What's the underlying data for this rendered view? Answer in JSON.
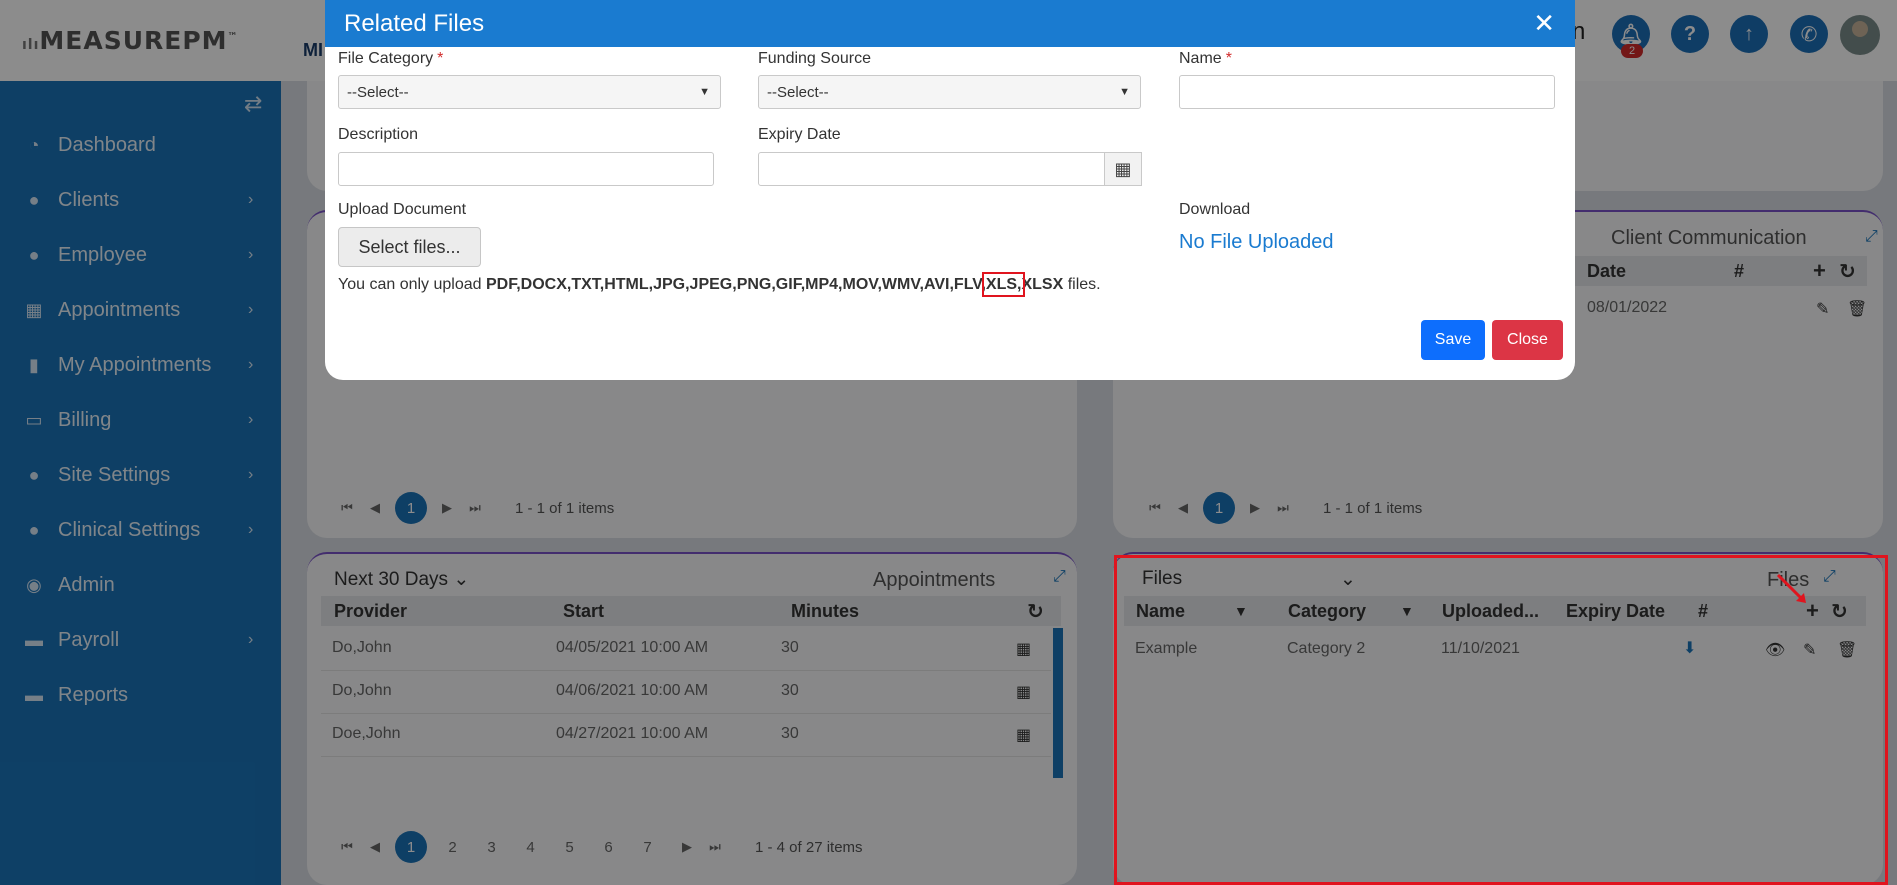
{
  "header": {
    "logo": "MEASUREPM",
    "logo_tm": "™",
    "logo2": "MI",
    "partial_title": "n",
    "notification_count": "2"
  },
  "sidebar": {
    "items": [
      {
        "label": "Dashboard",
        "icon": "dashboard-icon",
        "glyph": "◔",
        "chevron": false
      },
      {
        "label": "Clients",
        "icon": "user-icon",
        "glyph": "●",
        "chevron": true
      },
      {
        "label": "Employee",
        "icon": "users-icon",
        "glyph": "●",
        "chevron": true
      },
      {
        "label": "Appointments",
        "icon": "calendar-icon",
        "glyph": "▦",
        "chevron": true
      },
      {
        "label": "My Appointments",
        "icon": "book-icon",
        "glyph": "▮",
        "chevron": true
      },
      {
        "label": "Billing",
        "icon": "money-icon",
        "glyph": "▭",
        "chevron": true
      },
      {
        "label": "Site Settings",
        "icon": "user-icon",
        "glyph": "●",
        "chevron": true
      },
      {
        "label": "Clinical Settings",
        "icon": "user-icon",
        "glyph": "●",
        "chevron": true
      },
      {
        "label": "Admin",
        "icon": "user-circle-icon",
        "glyph": "◉",
        "chevron": false
      },
      {
        "label": "Payroll",
        "icon": "card-icon",
        "glyph": "▬",
        "chevron": true
      },
      {
        "label": "Reports",
        "icon": "card-icon",
        "glyph": "▬",
        "chevron": false
      }
    ]
  },
  "client_comm": {
    "title": "Client Communication",
    "col_date": "Date",
    "col_hash": "#",
    "row_date": "08/01/2022",
    "pager_page": "1",
    "pager_info": "1 - 1 of 1 items"
  },
  "left_top_panel": {
    "pager_page": "1",
    "pager_info": "1 - 1 of 1 items"
  },
  "appointments": {
    "filter": "Next 30 Days",
    "title": "Appointments",
    "columns": [
      "Provider",
      "Start",
      "Minutes"
    ],
    "rows": [
      [
        "Do,John",
        "04/05/2021 10:00 AM",
        "30"
      ],
      [
        "Do,John",
        "04/06/2021 10:00 AM",
        "30"
      ],
      [
        "Doe,John",
        "04/27/2021 10:00 AM",
        "30"
      ]
    ],
    "pages": [
      "1",
      "2",
      "3",
      "4",
      "5",
      "6",
      "7"
    ],
    "pager_info": "1 - 4 of 27 items"
  },
  "files_panel": {
    "filter": "Files",
    "title": "Files",
    "columns": [
      "Name",
      "Category",
      "Uploaded...",
      "Expiry Date",
      "#"
    ],
    "row": {
      "name": "Example",
      "category": "Category 2",
      "uploaded": "11/10/2021"
    }
  },
  "dialog": {
    "title": "Related Files",
    "file_category_label": "File Category",
    "file_category_value": "--Select--",
    "funding_source_label": "Funding Source",
    "funding_source_value": "--Select--",
    "name_label": "Name",
    "required_mark": "*",
    "description_label": "Description",
    "expiry_label": "Expiry Date",
    "upload_label": "Upload Document",
    "select_files": "Select files...",
    "hint_prefix": "You can only upload ",
    "hint_types_a": "PDF,DOCX,TXT,HTML,JPG,JPEG,PNG,GIF,MP4,MOV,WMV,AVI,FLV,",
    "hint_types_xls": "XLS,",
    "hint_types_b": "XLSX",
    "hint_suffix": " files.",
    "download_label": "Download",
    "no_file": "No File Uploaded",
    "save": "Save",
    "close": "Close"
  },
  "colors": {
    "sidebar": "#1a74b9",
    "dialog_header": "#1a7bd0",
    "save": "#0d6efd",
    "close": "#dc3545",
    "highlight": "#e0141e"
  }
}
